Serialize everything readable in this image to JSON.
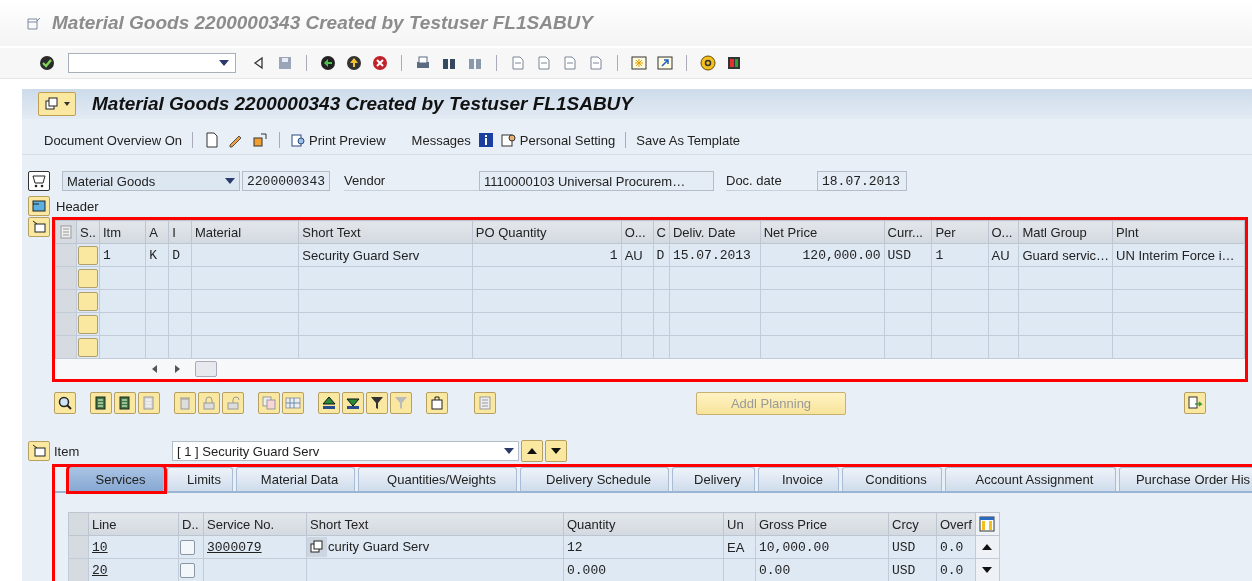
{
  "window": {
    "title": "Material Goods 2200000343 Created by Testuser FL1SABUY"
  },
  "screen": {
    "title": "Material Goods 2200000343 Created by Testuser FL1SABUY"
  },
  "app_toolbar": {
    "document_overview": "Document Overview On",
    "print_preview": "Print Preview",
    "messages": "Messages",
    "personal_setting": "Personal Setting",
    "save_as_template": "Save As Template"
  },
  "header_fields": {
    "doc_type": "Material Goods",
    "doc_number": "2200000343",
    "vendor_label": "Vendor",
    "vendor": "1110000103 Universal Procurem…",
    "doc_date_label": "Doc. date",
    "doc_date": "18.07.2013"
  },
  "header_toggle": {
    "label": "Header"
  },
  "items_table": {
    "highlighted": true,
    "columns": [
      "S..",
      "Itm",
      "A",
      "I",
      "Material",
      "Short Text",
      "PO Quantity",
      "O...",
      "C",
      "Deliv. Date",
      "Net Price",
      "Curr...",
      "Per",
      "O...",
      "Matl Group",
      "Plnt"
    ],
    "rows": [
      {
        "cells": [
          "",
          "1",
          "K",
          "D",
          null,
          "Security Guard Serv",
          "1",
          "AU",
          "D",
          "15.07.2013",
          "120,000.00",
          "USD",
          "1",
          "AU",
          "Guard servic…",
          "UN Interim Force i…"
        ]
      }
    ]
  },
  "addl_planning": {
    "label": "Addl Planning",
    "disabled": true
  },
  "item_selector": {
    "label": "Item",
    "value": "[ 1 ] Security Guard Serv"
  },
  "tab_strip": {
    "highlighted": true,
    "tabs": [
      {
        "label": "Services",
        "selected": true,
        "highlighted": true
      },
      {
        "label": "Limits",
        "selected": false,
        "highlighted": false
      },
      {
        "label": "Material Data",
        "selected": false,
        "highlighted": false
      },
      {
        "label": "Quantities/Weights",
        "selected": false,
        "highlighted": false
      },
      {
        "label": "Delivery Schedule",
        "selected": false,
        "highlighted": false
      },
      {
        "label": "Delivery",
        "selected": false,
        "highlighted": false
      },
      {
        "label": "Invoice",
        "selected": false,
        "highlighted": false
      },
      {
        "label": "Conditions",
        "selected": false,
        "highlighted": false
      },
      {
        "label": "Account Assignment",
        "selected": false,
        "highlighted": false
      },
      {
        "label": "Purchase Order His",
        "selected": false,
        "highlighted": false
      }
    ]
  },
  "services_table": {
    "columns": [
      "Line",
      "D..",
      "Service No.",
      "Short Text",
      "Quantity",
      "Un",
      "Gross Price",
      "Crcy",
      "Overf"
    ],
    "rows": [
      {
        "checked": false,
        "cells": [
          "10",
          "",
          "3000079",
          "curity Guard Serv",
          "12",
          "EA",
          "10,000.00",
          "USD",
          "0.0"
        ]
      },
      {
        "checked": false,
        "cells": [
          "20",
          "",
          null,
          null,
          "0.000",
          null,
          "0.00",
          "USD",
          "0.0"
        ]
      }
    ]
  }
}
